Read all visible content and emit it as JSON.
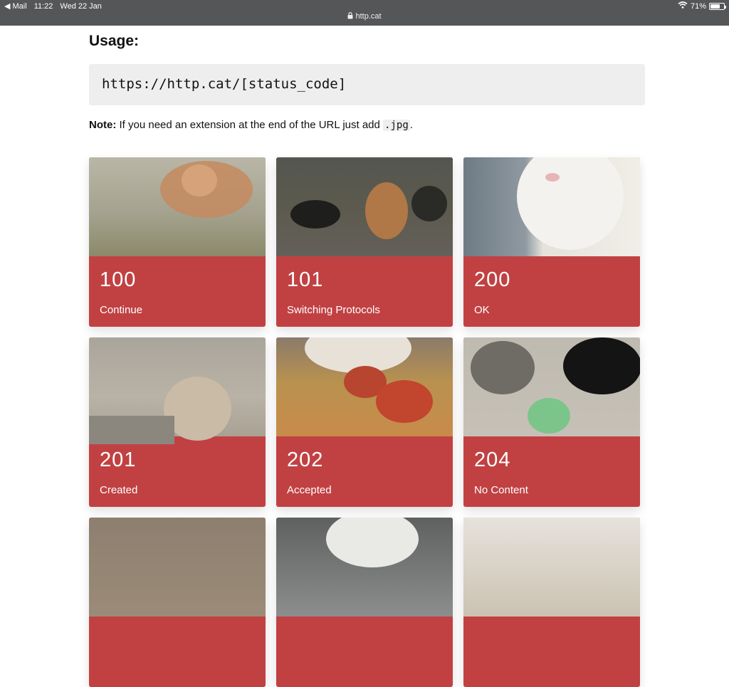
{
  "statusbar": {
    "app": "◀ Mail",
    "time": "11:22",
    "date": "Wed 22 Jan",
    "url": "http.cat",
    "battery": "71%",
    "battery_level": 0.71
  },
  "usage": {
    "title": "Usage:",
    "code": "https://http.cat/[status_code]"
  },
  "note": {
    "label": "Note:",
    "text": " If you need an extension at the end of the URL just add ",
    "ext": ".jpg",
    "end": "."
  },
  "cards": [
    {
      "code": "100",
      "label": "Continue"
    },
    {
      "code": "101",
      "label": "Switching Protocols"
    },
    {
      "code": "200",
      "label": "OK"
    },
    {
      "code": "201",
      "label": "Created"
    },
    {
      "code": "202",
      "label": "Accepted"
    },
    {
      "code": "204",
      "label": "No Content"
    }
  ],
  "colors": {
    "card": "#c14143",
    "statusbar": "#555658",
    "code_bg": "#eeeeee"
  }
}
